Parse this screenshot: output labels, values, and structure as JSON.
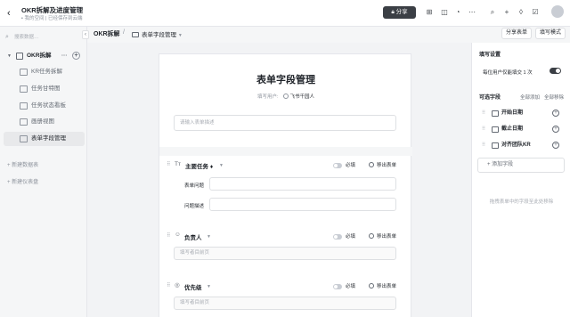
{
  "header": {
    "title": "OKR拆解及进度管理",
    "location": "我的空间",
    "save_status": "已经保存到云端",
    "share_label": "分享"
  },
  "sidebar": {
    "search_placeholder": "搜索数据…",
    "root": {
      "label": "OKR拆解",
      "more": "···"
    },
    "items": [
      {
        "label": "KR任务拆解"
      },
      {
        "label": "任务甘特图"
      },
      {
        "label": "任务状态看板"
      },
      {
        "label": "画册视图"
      },
      {
        "label": "表单字段管理"
      }
    ],
    "new_table": "+ 新建数据表",
    "new_dashboard": "+ 新建仪表盘"
  },
  "breadcrumb": {
    "root": "OKR拆解",
    "separator": "/",
    "current": "表单字段管理",
    "share_form": "分享表单",
    "fill_mode": "填写模式"
  },
  "form": {
    "title": "表单字段管理",
    "filler_label": "填写用户:",
    "filler_value": "飞书千园人",
    "desc_placeholder": "请输入表单描述",
    "fields": [
      {
        "name": "主要任务",
        "required_label": "必填",
        "remove_label": "移出表单",
        "sub_rows": [
          {
            "label": "表单问题"
          },
          {
            "label": "问题描述"
          }
        ]
      },
      {
        "name": "负责人",
        "required_label": "必填",
        "remove_label": "移出表单",
        "placeholder": "填写者目前页"
      },
      {
        "name": "优先级",
        "required_label": "必填",
        "remove_label": "移出表单",
        "placeholder": "填写者目前页"
      }
    ]
  },
  "right_panel": {
    "settings_title": "填写设置",
    "limit_label": "每位用户仅能填交 1 次",
    "optional_title": "可选字段",
    "add_all": "全部添加",
    "remove_all": "全部移除",
    "optional_fields": [
      {
        "label": "开始日期"
      },
      {
        "label": "截止日期"
      },
      {
        "label": "对齐团队KR"
      }
    ],
    "add_field": "+ 添加字段",
    "note": "拖拽表单中的字段至此处移除"
  },
  "colors": {
    "accent": "#3b3f45",
    "border": "#dee0e3",
    "canvas": "#f2f3f5"
  }
}
